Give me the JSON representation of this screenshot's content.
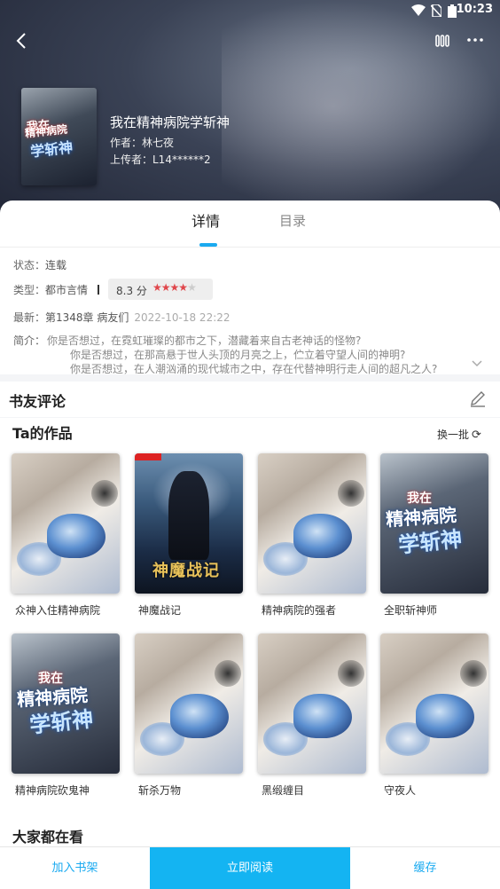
{
  "status_bar": {
    "time": "10:23"
  },
  "book": {
    "title": "我在精神病院学斩神",
    "author": "作者：林七夜",
    "uploader": "上传者：L14******2",
    "cover_text_top": "我在",
    "cover_text_main": "精神病院",
    "cover_text_sub": "学斩神"
  },
  "tabs": [
    {
      "label": "详情",
      "active": true
    },
    {
      "label": "目录",
      "active": false
    }
  ],
  "details": {
    "status_label": "状态：",
    "status_value": "连载",
    "type_label": "类型：",
    "type_value": "都市言情",
    "rating_score": "8.3 分",
    "rating_stars": 4,
    "latest_label": "最新：",
    "latest_value": "第1348章 病友们",
    "latest_date": "2022-10-18 22:22",
    "intro_label": "简介：",
    "intro_lines": [
      "你是否想过，在霓虹璀璨的都市之下，潜藏着来自古老神话的怪物?",
      "你是否想过，在那高悬于世人头顶的月亮之上，伫立着守望人间的神明?",
      "你是否想过，在人潮汹涌的现代城市之中，存在代替神明行走人间的超凡之人?"
    ]
  },
  "comments": {
    "heading": "书友评论"
  },
  "works": {
    "heading": "Ta的作品",
    "refresh_label": "换一批",
    "books": [
      {
        "name": "众神入住精神病院",
        "cover": "paint"
      },
      {
        "name": "神魔战记",
        "cover": "devil",
        "cover_title": "神魔战记"
      },
      {
        "name": "精神病院的强者",
        "cover": "paint"
      },
      {
        "name": "全职斩神师",
        "cover": "asylum"
      },
      {
        "name": "精神病院砍鬼神",
        "cover": "asylum"
      },
      {
        "name": "斩杀万物",
        "cover": "paint"
      },
      {
        "name": "黑缎缠目",
        "cover": "paint"
      },
      {
        "name": "守夜人",
        "cover": "paint"
      }
    ]
  },
  "everyone_reading": {
    "heading": "大家都在看"
  },
  "bottom_bar": {
    "add_shelf": "加入书架",
    "read_now": "立即阅读",
    "cache": "缓存"
  },
  "colors": {
    "accent": "#14b4f2",
    "star": "#e0474c"
  }
}
